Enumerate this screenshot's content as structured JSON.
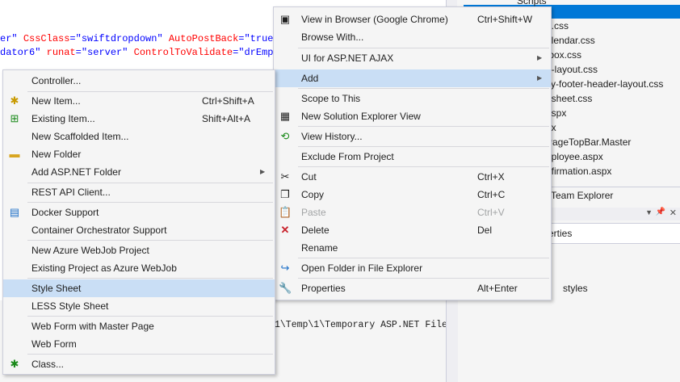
{
  "editor": {
    "line1": {
      "p1": "er\"",
      "a1": "CssClass",
      "v1": "\"swiftdropdown\"",
      "a2": "AutoPostBack",
      "v2": "\"true\""
    },
    "line2": {
      "p1": "dator6\"",
      "a1": "runat",
      "v1": "\"server\"",
      "a2": "ControlToValidate",
      "v2": "\"drEmpl"
    },
    "output_text": "1\\Temp\\1\\Temporary ASP.NET File"
  },
  "solution_explorer": {
    "items": [
      "Scripts",
      "e.css",
      "alendar.css",
      "tbox.css",
      "n-layout.css",
      "ky-footer-header-layout.css",
      "esheet.css",
      "aspx",
      "px",
      "PageTopBar.Master",
      "nployee.aspx",
      "nfirmation.aspx"
    ],
    "team_explorer_tab": "Team Explorer",
    "properties_title": "erties",
    "properties_value": "styles"
  },
  "context_menu": {
    "items": [
      {
        "label": "View in Browser (Google Chrome)",
        "shortcut": "Ctrl+Shift+W",
        "icon": "browser-icon"
      },
      {
        "label": "Browse With...",
        "shortcut": "",
        "icon": ""
      },
      {
        "label": "UI for ASP.NET AJAX",
        "shortcut": "",
        "icon": ""
      },
      {
        "label": "Add",
        "shortcut": "",
        "icon": ""
      },
      {
        "label": "Scope to This",
        "shortcut": "",
        "icon": ""
      },
      {
        "label": "New Solution Explorer View",
        "shortcut": "",
        "icon": "solution-view-icon"
      },
      {
        "label": "View History...",
        "shortcut": "",
        "icon": "history-icon"
      },
      {
        "label": "Exclude From Project",
        "shortcut": "",
        "icon": ""
      },
      {
        "label": "Cut",
        "shortcut": "Ctrl+X",
        "icon": "scissors-icon"
      },
      {
        "label": "Copy",
        "shortcut": "Ctrl+C",
        "icon": "copy-icon"
      },
      {
        "label": "Paste",
        "shortcut": "Ctrl+V",
        "icon": "paste-icon"
      },
      {
        "label": "Delete",
        "shortcut": "Del",
        "icon": "delete-icon"
      },
      {
        "label": "Rename",
        "shortcut": "",
        "icon": ""
      },
      {
        "label": "Open Folder in File Explorer",
        "shortcut": "",
        "icon": "open-folder-icon"
      },
      {
        "label": "Properties",
        "shortcut": "Alt+Enter",
        "icon": "wrench-icon"
      }
    ]
  },
  "add_submenu": {
    "items": [
      {
        "label": "Controller...",
        "shortcut": "",
        "icon": ""
      },
      {
        "label": "New Item...",
        "shortcut": "Ctrl+Shift+A",
        "icon": "new-item-icon"
      },
      {
        "label": "Existing Item...",
        "shortcut": "Shift+Alt+A",
        "icon": "existing-item-icon"
      },
      {
        "label": "New Scaffolded Item...",
        "shortcut": "",
        "icon": ""
      },
      {
        "label": "New Folder",
        "shortcut": "",
        "icon": "new-folder-icon"
      },
      {
        "label": "Add ASP.NET Folder",
        "shortcut": "",
        "icon": ""
      },
      {
        "label": "REST API Client...",
        "shortcut": "",
        "icon": ""
      },
      {
        "label": "Docker Support",
        "shortcut": "",
        "icon": "docker-icon"
      },
      {
        "label": "Container Orchestrator Support",
        "shortcut": "",
        "icon": ""
      },
      {
        "label": "New Azure WebJob Project",
        "shortcut": "",
        "icon": ""
      },
      {
        "label": "Existing Project as Azure WebJob",
        "shortcut": "",
        "icon": ""
      },
      {
        "label": "Style Sheet",
        "shortcut": "",
        "icon": ""
      },
      {
        "label": "LESS Style Sheet",
        "shortcut": "",
        "icon": ""
      },
      {
        "label": "Web Form with Master Page",
        "shortcut": "",
        "icon": ""
      },
      {
        "label": "Web Form",
        "shortcut": "",
        "icon": ""
      },
      {
        "label": "Class...",
        "shortcut": "",
        "icon": "class-icon"
      }
    ]
  },
  "colors": {
    "selection": "#0078d7",
    "menu_highlight": "#c9def5"
  }
}
